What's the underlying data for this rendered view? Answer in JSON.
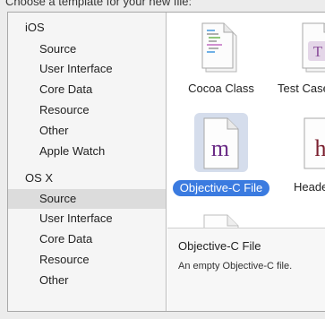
{
  "header": {
    "text": "Choose a template for your new file:"
  },
  "sidebar": {
    "sections": [
      {
        "title": "iOS",
        "items": [
          "Source",
          "User Interface",
          "Core Data",
          "Resource",
          "Other",
          "Apple Watch"
        ]
      },
      {
        "title": "OS X",
        "items": [
          "Source",
          "User Interface",
          "Core Data",
          "Resource",
          "Other"
        ]
      }
    ],
    "selected": "OS X / Source"
  },
  "templates": [
    {
      "label": "Cocoa Class",
      "icon": "cocoa-class-file-icon"
    },
    {
      "label": "Test Case Class",
      "icon": "test-case-file-icon"
    },
    {
      "label": "Objective-C File",
      "icon": "objective-c-m-file-icon",
      "selected": true
    },
    {
      "label": "Header File",
      "icon": "header-h-file-icon"
    },
    {
      "label": "",
      "icon": "blank-file-icon"
    }
  ],
  "detail": {
    "title": "Objective-C File",
    "description": "An empty Objective-C file."
  },
  "colors": {
    "selection": "#3b7be0",
    "m_letter": "#6b2c86",
    "h_letter": "#7a1f2e"
  }
}
